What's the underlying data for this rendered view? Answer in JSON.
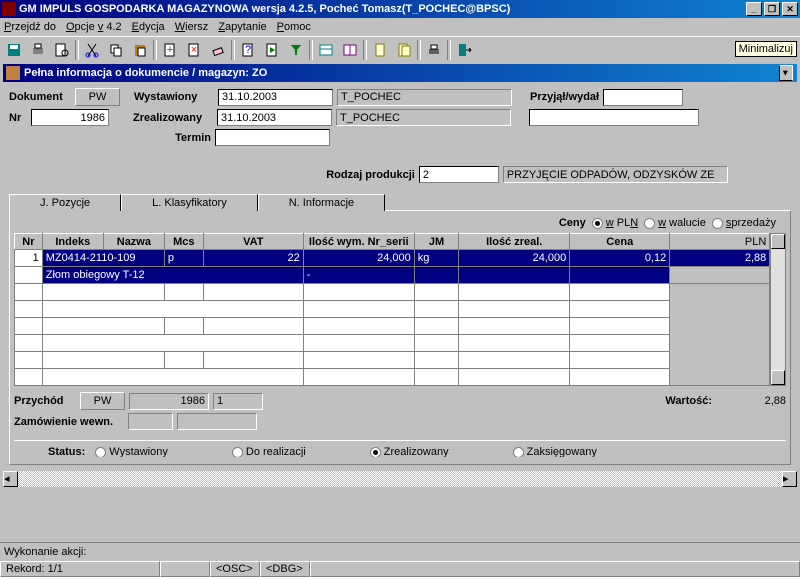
{
  "title_bar": "GM IMPULS GOSPODARKA MAGAZYNOWA wersja 4.2.5, Pocheć Tomasz(T_POCHEC@BPSC)",
  "tooltip": "Minimalizuj",
  "menu": [
    "Przejdź do",
    "Opcje v 4.2",
    "Edycja",
    "Wiersz",
    "Zapytanie",
    "Pomoc"
  ],
  "sub_title": "Pełna informacja o dokumencie / magazyn: ZO",
  "form": {
    "dokument_label": "Dokument",
    "dokument_value": "PW",
    "nr_label": "Nr",
    "nr_value": "1986",
    "wystawiony_label": "Wystawiony",
    "wystawiony_value": "31.10.2003",
    "wystawiony_user": "T_POCHEC",
    "zrealizowany_label": "Zrealizowany",
    "zrealizowany_value": "31.10.2003",
    "zrealizowany_user": "T_POCHEC",
    "termin_label": "Termin",
    "termin_value": "",
    "przyjal_label": "Przyjął/wydał",
    "przyjal_value": "",
    "rodzaj_label": "Rodzaj produkcji",
    "rodzaj_value": "2",
    "rodzaj_desc": "PRZYJĘCIE ODPADÓW, ODZYSKÓW ZE"
  },
  "tabs": [
    "J. Pozycje",
    "L. Klasyfikatory",
    "N. Informacje"
  ],
  "ceny_label": "Ceny",
  "ceny_options": [
    "w PLN",
    "w walucie",
    "sprzedaży"
  ],
  "ceny_selected": 0,
  "grid": {
    "cols": [
      "Nr",
      "Indeks",
      "Nazwa",
      "Mcs",
      "VAT",
      "Ilość wym. Nr_serii",
      "JM",
      "Ilość zreal.",
      "Cena",
      "PLN"
    ],
    "row1": {
      "nr": "1",
      "indeks": "MZ0414-2110-109",
      "nazwa": "",
      "mcs": "p",
      "vat": "22",
      "ilosc": "24,000",
      "jm": "kg",
      "ilosc_z": "24,000",
      "cena": "0,12",
      "pln": "2,88"
    },
    "row2_nazwa": "Złom obiegowy T-12"
  },
  "footer": {
    "przychod_label": "Przychód",
    "przychod_v1": "PW",
    "przychod_v2": "1986",
    "przychod_v3": "1",
    "zamowienie_label": "Zamówienie wewn.",
    "wartosc_label": "Wartość:",
    "wartosc_value": "2,88"
  },
  "statuses": {
    "label": "Status:",
    "opts": [
      "Wystawiony",
      "Do realizacji",
      "Zrealizowany",
      "Zaksięgowany"
    ],
    "sel": 2
  },
  "statusbar": {
    "left": "Wykonanie akcji:",
    "rekord": "Rekord: 1/1",
    "osc": "<OSC>",
    "dbg": "<DBG>"
  }
}
